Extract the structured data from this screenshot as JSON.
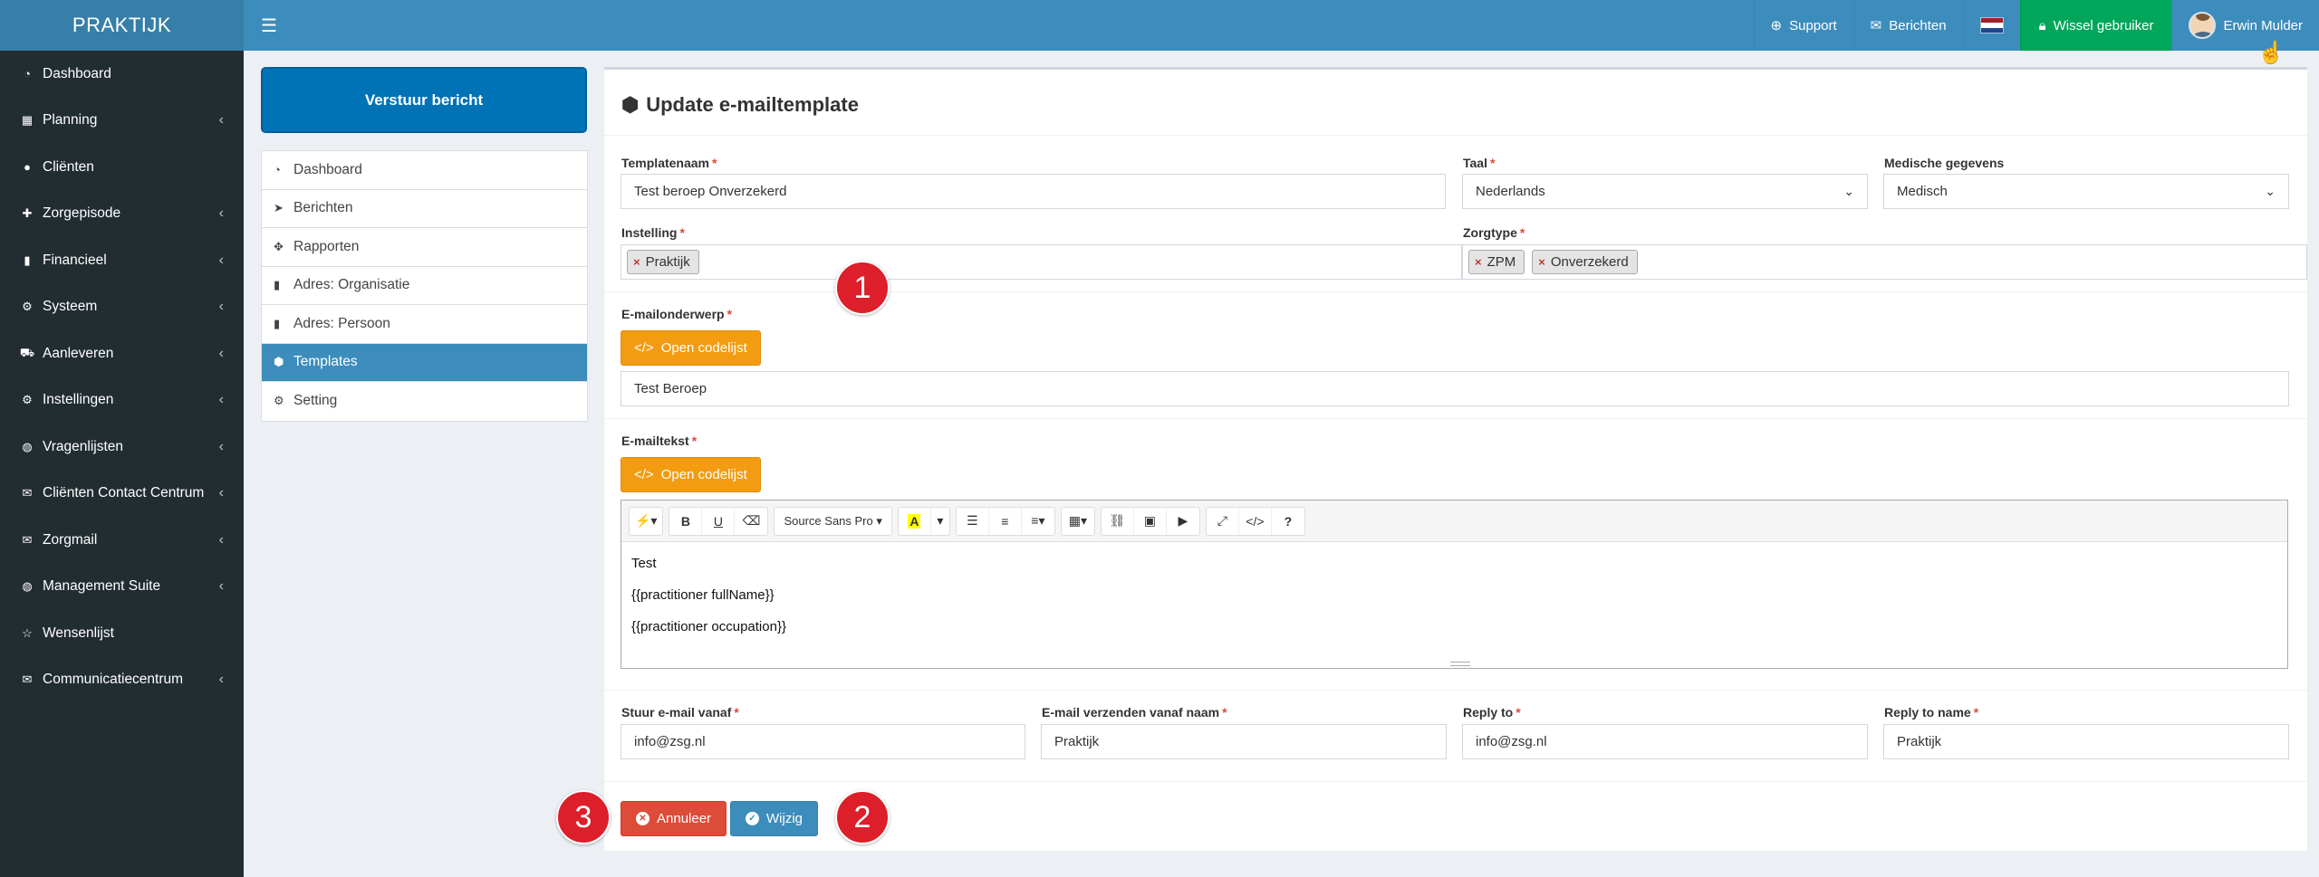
{
  "topbar": {
    "logo": "PRAKTIJK",
    "support": "Support",
    "messages": "Berichten",
    "switch_user": "Wissel gebruiker",
    "user_name": "Erwin Mulder"
  },
  "sidebar": {
    "items": [
      {
        "label": "Dashboard",
        "icon": "dashboard-icon",
        "chevron": ""
      },
      {
        "label": "Planning",
        "icon": "calendar-icon",
        "chevron": "‹"
      },
      {
        "label": "Cliënten",
        "icon": "user-icon",
        "chevron": ""
      },
      {
        "label": "Zorgepisode",
        "icon": "medkit-icon",
        "chevron": "‹"
      },
      {
        "label": "Financieel",
        "icon": "book-icon",
        "chevron": "‹"
      },
      {
        "label": "Systeem",
        "icon": "cogs-icon",
        "chevron": "‹"
      },
      {
        "label": "Aanleveren",
        "icon": "truck-icon",
        "chevron": "‹"
      },
      {
        "label": "Instellingen",
        "icon": "gear-icon",
        "chevron": "‹"
      },
      {
        "label": "Vragenlijsten",
        "icon": "globe-icon",
        "chevron": "‹"
      },
      {
        "label": "Cliënten Contact Centrum",
        "icon": "envelope-icon",
        "chevron": "‹"
      },
      {
        "label": "Zorgmail",
        "icon": "envelope-icon",
        "chevron": "‹"
      },
      {
        "label": "Management Suite",
        "icon": "globe-icon",
        "chevron": "‹"
      },
      {
        "label": "Wensenlijst",
        "icon": "star-icon",
        "chevron": ""
      },
      {
        "label": "Communicatiecentrum",
        "icon": "envelope-icon",
        "chevron": "‹"
      }
    ]
  },
  "send_button": "Verstuur bericht",
  "submenu": {
    "items": [
      {
        "label": "Dashboard",
        "icon": "dashboard-icon"
      },
      {
        "label": "Berichten",
        "icon": "paper-plane-icon"
      },
      {
        "label": "Rapporten",
        "icon": "puzzle-icon"
      },
      {
        "label": "Adres: Organisatie",
        "icon": "book-icon"
      },
      {
        "label": "Adres: Persoon",
        "icon": "book-icon"
      },
      {
        "label": "Templates",
        "icon": "cubes-icon"
      },
      {
        "label": "Setting",
        "icon": "cogs-icon"
      }
    ]
  },
  "form": {
    "title": "Update e-mailtemplate",
    "template_name_label": "Templatenaam",
    "template_name_value": "Test beroep Onverzekerd",
    "language_label": "Taal",
    "language_value": "Nederlands",
    "medical_label": "Medische gegevens",
    "medical_value": "Medisch",
    "institution_label": "Instelling",
    "institution_tags": [
      "Praktijk"
    ],
    "caretype_label": "Zorgtype",
    "caretype_tags": [
      "ZPM",
      "Onverzekerd"
    ],
    "subject_label": "E-mailonderwerp",
    "open_codelist": "Open codelijst",
    "subject_value": "Test Beroep",
    "body_label": "E-mailtekst",
    "font_name": "Source Sans Pro",
    "body_lines": [
      "Test",
      "{{practitioner fullName}}",
      "{{practitioner occupation}}"
    ],
    "from_email_label": "Stuur e-mail vanaf",
    "from_email_value": "info@zsg.nl",
    "from_name_label": "E-mail verzenden vanaf naam",
    "from_name_value": "Praktijk",
    "reply_to_label": "Reply to",
    "reply_to_value": "info@zsg.nl",
    "reply_name_label": "Reply to name",
    "reply_name_value": "Praktijk",
    "cancel_label": "Annuleer",
    "save_label": "Wijzig"
  },
  "markers": [
    "1",
    "2",
    "3"
  ],
  "colors": {
    "header": "#3c8dbc",
    "sidebar": "#222d32",
    "active": "#3c8dbc",
    "success": "#00a65a",
    "warning": "#f39c12",
    "danger": "#dd4b39",
    "marker": "#dc1f2a"
  }
}
